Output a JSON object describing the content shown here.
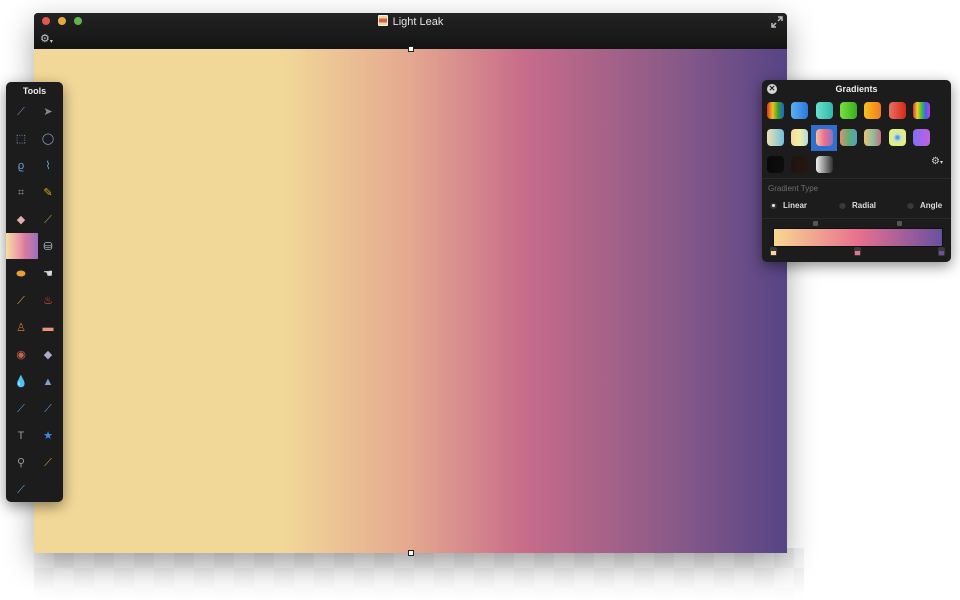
{
  "window": {
    "title": "Light Leak",
    "title_icon": "document-icon",
    "toolbar_gear_icon": "gear-icon",
    "fullscreen_icon": "fullscreen-icon"
  },
  "canvas": {
    "gradient_colors": [
      "#f2d898",
      "#c86c8a",
      "#564486"
    ]
  },
  "tools_panel": {
    "title": "Tools",
    "tools": [
      {
        "name": "magic-wand",
        "glyph": "⟋",
        "color": "#b070d0"
      },
      {
        "name": "move",
        "glyph": "➤",
        "color": "#8a8a8a"
      },
      {
        "name": "rect-select",
        "glyph": "⬚",
        "color": "#8a9ad0"
      },
      {
        "name": "ellipse-select",
        "glyph": "◯",
        "color": "#8a9ad0"
      },
      {
        "name": "lasso",
        "glyph": "ϱ",
        "color": "#6aa0d0"
      },
      {
        "name": "polygon-lasso",
        "glyph": "⌇",
        "color": "#6aa0d0"
      },
      {
        "name": "crop",
        "glyph": "⌗",
        "color": "#8a8a8a"
      },
      {
        "name": "pencil",
        "glyph": "✎",
        "color": "#e8a020"
      },
      {
        "name": "eraser",
        "glyph": "◆",
        "color": "#e0b0b0"
      },
      {
        "name": "brush",
        "glyph": "⟋",
        "color": "#8ab040"
      },
      {
        "name": "gradient",
        "glyph": "",
        "color": ""
      },
      {
        "name": "paint-bucket",
        "glyph": "⛁",
        "color": "#c0c8e0"
      },
      {
        "name": "burn",
        "glyph": "⬬",
        "color": "#e8a030"
      },
      {
        "name": "smudge",
        "glyph": "☚",
        "color": "#d8d8d8"
      },
      {
        "name": "dodge",
        "glyph": "⟋",
        "color": "#e8a030"
      },
      {
        "name": "flame",
        "glyph": "♨",
        "color": "#f06020"
      },
      {
        "name": "clone-stamp",
        "glyph": "♙",
        "color": "#c87a30"
      },
      {
        "name": "bandage",
        "glyph": "▬",
        "color": "#f09080"
      },
      {
        "name": "red-eye",
        "glyph": "◉",
        "color": "#c86050"
      },
      {
        "name": "eraser-alt",
        "glyph": "◆",
        "color": "#b0a8c8"
      },
      {
        "name": "blur",
        "glyph": "💧",
        "color": "#6aa0e0"
      },
      {
        "name": "sharpen",
        "glyph": "▲",
        "color": "#7aa0d8"
      },
      {
        "name": "pen",
        "glyph": "⟋",
        "color": "#5aa0f0"
      },
      {
        "name": "freeform-pen",
        "glyph": "⟋",
        "color": "#5aa0f0"
      },
      {
        "name": "text",
        "glyph": "T",
        "color": "#9a9a9a"
      },
      {
        "name": "shape",
        "glyph": "★",
        "color": "#3a8af0"
      },
      {
        "name": "zoom",
        "glyph": "⚲",
        "color": "#9a9a9a"
      },
      {
        "name": "eyedropper",
        "glyph": "⟋",
        "color": "#e89030"
      },
      {
        "name": "color-picker",
        "glyph": "⟋",
        "color": "#5aa0f0"
      }
    ]
  },
  "gradients_panel": {
    "title": "Gradients",
    "close_icon": "close-icon",
    "presets": [
      {
        "name": "rainbow",
        "colors": [
          "#e03020",
          "#f0c020",
          "#30a030",
          "#2060e0"
        ]
      },
      {
        "name": "blue",
        "colors": [
          "#5ab0f0",
          "#2a78e0"
        ]
      },
      {
        "name": "teal",
        "colors": [
          "#6ae0d0",
          "#30b8a8"
        ]
      },
      {
        "name": "green",
        "colors": [
          "#7ae040",
          "#38b020"
        ]
      },
      {
        "name": "orange",
        "colors": [
          "#f8c020",
          "#f07a20"
        ]
      },
      {
        "name": "red",
        "colors": [
          "#e87060",
          "#d82818"
        ]
      },
      {
        "name": "spectrum",
        "colors": [
          "#e03040",
          "#f0d020",
          "#40c040",
          "#4060f0",
          "#c040e0"
        ]
      },
      {
        "name": "sky-sand",
        "colors": [
          "#f0e0b0",
          "#70c0e0"
        ]
      },
      {
        "name": "pastel-yellow",
        "colors": [
          "#f8d8a0",
          "#f0f0a0",
          "#b0d8e8"
        ]
      },
      {
        "name": "light-leak",
        "colors": [
          "#f8c0a0",
          "#e87090",
          "#9070c0"
        ]
      },
      {
        "name": "green-mix",
        "colors": [
          "#e09070",
          "#60b070",
          "#50a0c0"
        ]
      },
      {
        "name": "stripes",
        "colors": [
          "#f0c070",
          "#90c0a0",
          "#c07080"
        ]
      },
      {
        "name": "radial-lime",
        "colors": [
          "#e0f080",
          "#d0e870"
        ]
      },
      {
        "name": "violet",
        "colors": [
          "#8070f0",
          "#c060e0"
        ]
      },
      {
        "name": "black",
        "colors": [
          "#080808",
          "#0e0e0e"
        ]
      },
      {
        "name": "dark-brown",
        "colors": [
          "#1e1410",
          "#24180f"
        ]
      },
      {
        "name": "grayscale",
        "colors": [
          "#f0f0f0",
          "#303030"
        ]
      }
    ],
    "selected_preset": "light-leak",
    "settings_icon": "gear-icon",
    "gradient_type_label": "Gradient Type",
    "types": [
      {
        "label": "Linear",
        "checked": true
      },
      {
        "label": "Radial",
        "checked": false
      },
      {
        "label": "Angle",
        "checked": false
      }
    ],
    "stops": [
      {
        "position": 0,
        "color": "#f8d890"
      },
      {
        "position": 0.5,
        "color": "#e87090"
      },
      {
        "position": 1,
        "color": "#6a50a0"
      }
    ],
    "midpoints": [
      0.25,
      0.75
    ]
  }
}
